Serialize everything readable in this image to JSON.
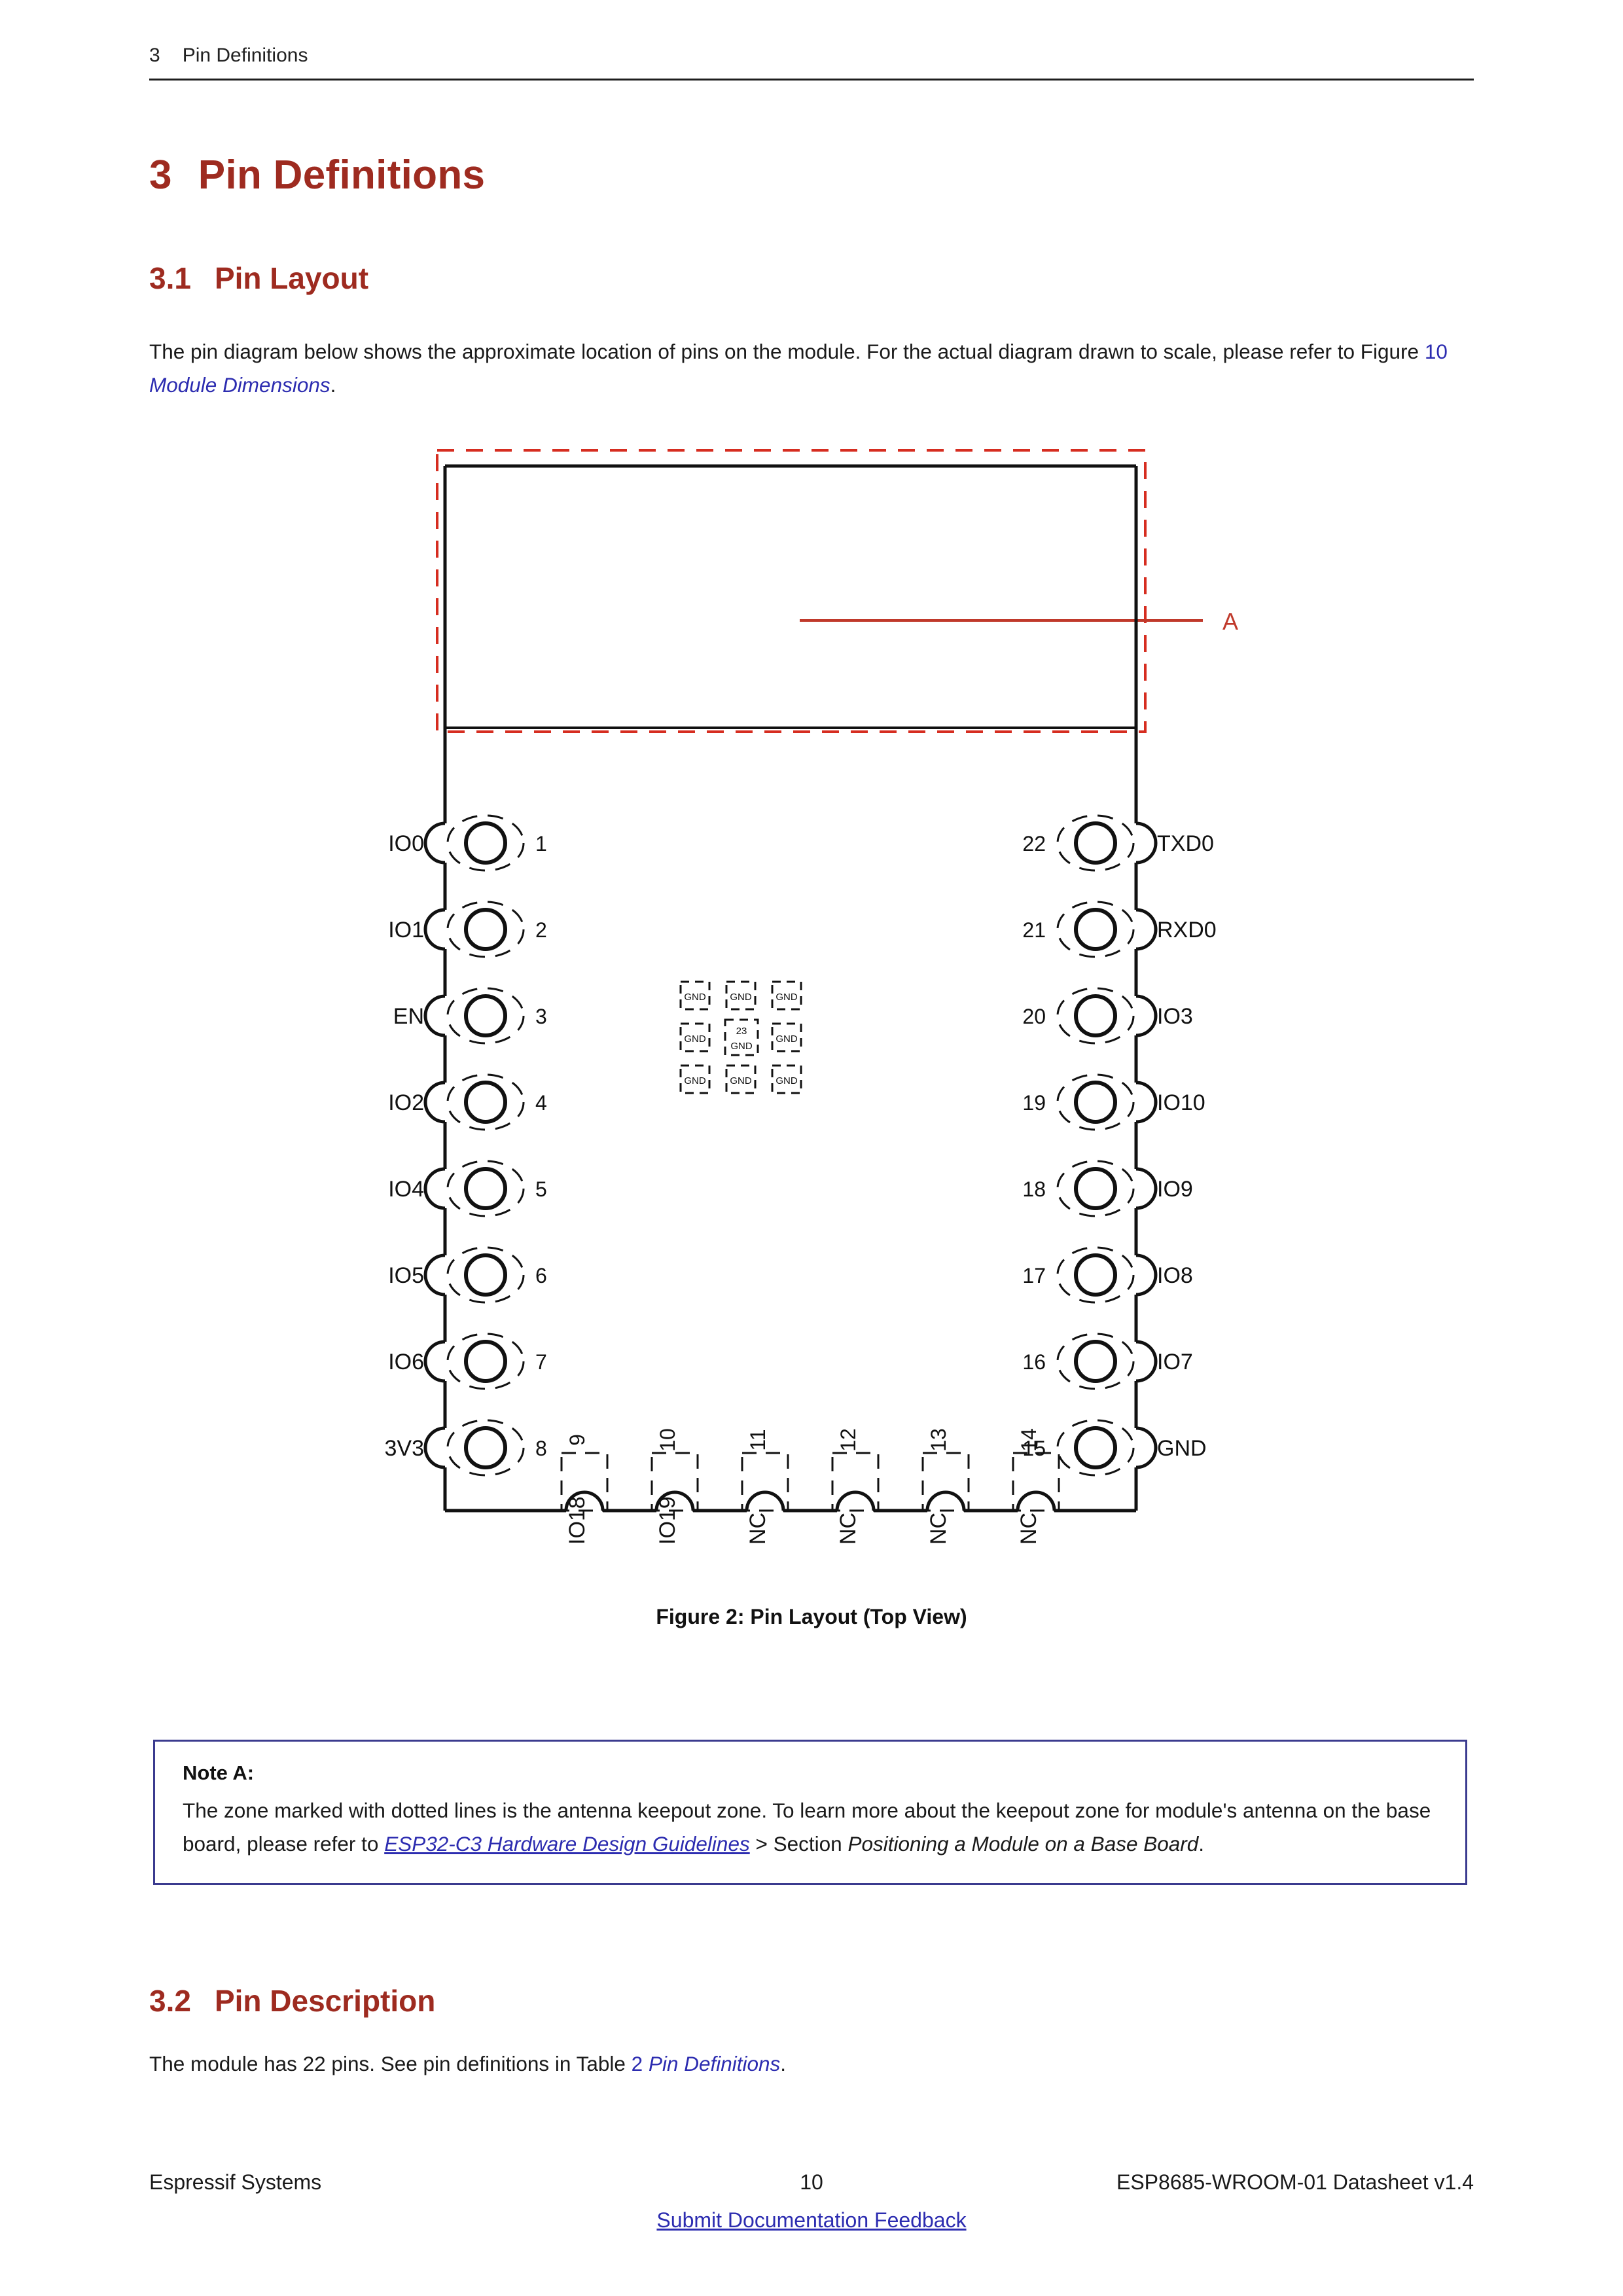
{
  "running_header": {
    "number": "3",
    "title": "Pin Definitions"
  },
  "headings": {
    "h3": {
      "number": "3",
      "title": "Pin Definitions"
    },
    "h31": {
      "number": "3.1",
      "title": "Pin Layout"
    },
    "h32": {
      "number": "3.2",
      "title": "Pin Description"
    }
  },
  "paragraphs": {
    "pin_layout": {
      "part1": "The pin diagram below shows the approximate location of pins on the module. For the actual diagram drawn to scale, please refer to Figure ",
      "xref_num": "10",
      "xref_text": " Module Dimensions",
      "part2": "."
    },
    "pin_description": {
      "part1": "The module has 22 pins. See pin definitions in Table ",
      "xref_num": "2",
      "xref_text": " Pin Definitions",
      "part2": "."
    }
  },
  "figure": {
    "caption": "Figure 2: Pin Layout (Top View)",
    "keepout_label": "A",
    "center_pads": [
      [
        "GND",
        "GND",
        "GND"
      ],
      [
        "GND",
        "23\nGND",
        "GND"
      ],
      [
        "GND",
        "GND",
        "GND"
      ]
    ],
    "center_pad_number": "23",
    "center_pad_name": "GND",
    "left_pins": [
      {
        "number": "1",
        "name": "IO0"
      },
      {
        "number": "2",
        "name": "IO1"
      },
      {
        "number": "3",
        "name": "EN"
      },
      {
        "number": "4",
        "name": "IO2"
      },
      {
        "number": "5",
        "name": "IO4"
      },
      {
        "number": "6",
        "name": "IO5"
      },
      {
        "number": "7",
        "name": "IO6"
      },
      {
        "number": "8",
        "name": "3V3"
      }
    ],
    "right_pins": [
      {
        "number": "22",
        "name": "TXD0"
      },
      {
        "number": "21",
        "name": "RXD0"
      },
      {
        "number": "20",
        "name": "IO3"
      },
      {
        "number": "19",
        "name": "IO10"
      },
      {
        "number": "18",
        "name": "IO9"
      },
      {
        "number": "17",
        "name": "IO8"
      },
      {
        "number": "16",
        "name": "IO7"
      },
      {
        "number": "15",
        "name": "GND"
      }
    ],
    "bottom_pins": [
      {
        "number": "9",
        "name": "IO18"
      },
      {
        "number": "10",
        "name": "IO19"
      },
      {
        "number": "11",
        "name": "NC"
      },
      {
        "number": "12",
        "name": "NC"
      },
      {
        "number": "13",
        "name": "NC"
      },
      {
        "number": "14",
        "name": "NC"
      }
    ]
  },
  "note": {
    "title": "Note A:",
    "text_part1": "The zone marked with dotted lines is the antenna keepout zone. To learn more about the keepout zone for module's antenna on the base board, please refer to ",
    "link_text": "ESP32-C3 Hardware Design Guidelines",
    "text_part2": " > Section ",
    "italic_tail": "Positioning a Module on a Base Board",
    "text_part3": "."
  },
  "footer": {
    "left": "Espressif Systems",
    "page_number": "10",
    "right": "ESP8685-WROOM-01 Datasheet v1.4",
    "link": "Submit Documentation Feedback"
  },
  "colors": {
    "heading_red": "#9e2b20",
    "link_blue": "#2c2cb0",
    "keepout_red": "#d62d20",
    "note_border": "#3b3b8f"
  }
}
